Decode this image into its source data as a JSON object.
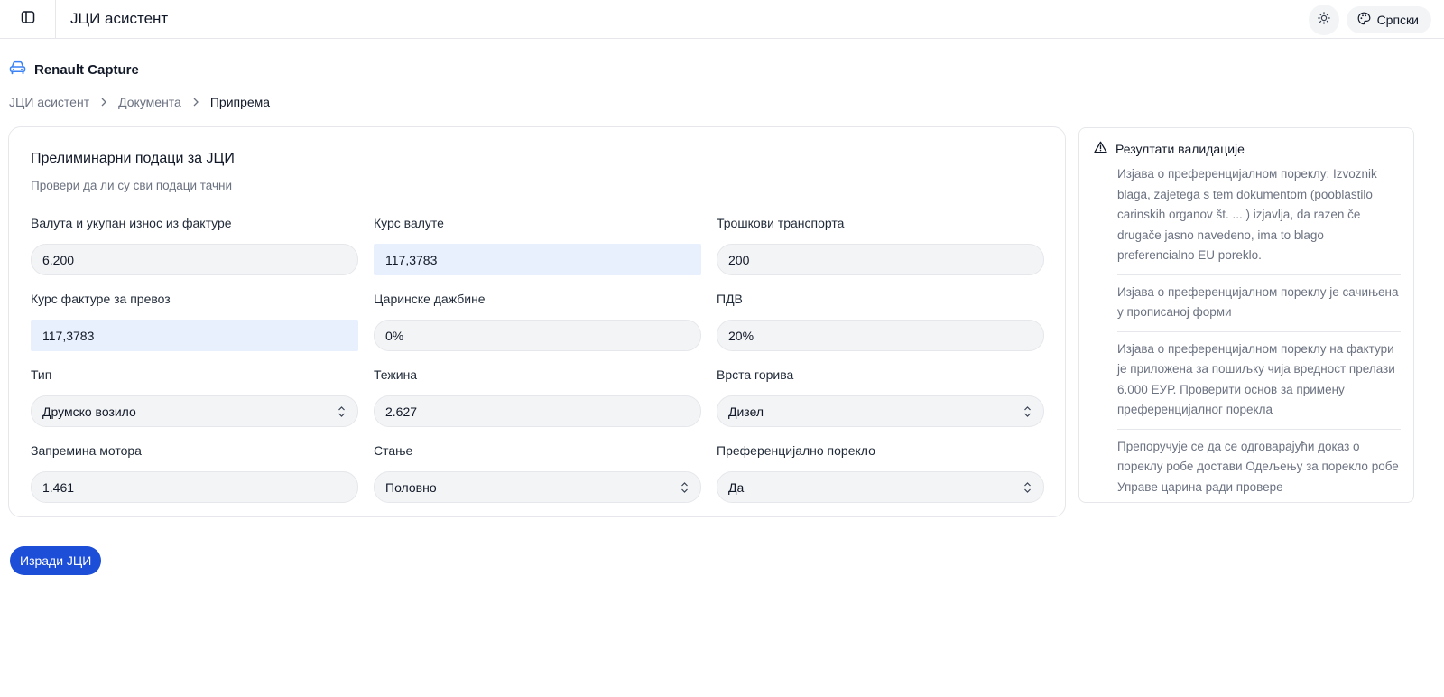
{
  "header": {
    "app_title": "ЈЦИ асистент",
    "language_label": "Српски"
  },
  "vehicle": {
    "name": "Renault Capture"
  },
  "breadcrumb": {
    "items": [
      "ЈЦИ асистент",
      "Документа",
      "Припрема"
    ]
  },
  "form": {
    "title": "Прелиминарни подаци за ЈЦИ",
    "subtitle": "Провери да ли су сви подаци тачни",
    "fields": [
      {
        "label": "Валута и укупан износ из фактуре",
        "value": "6.200",
        "type": "text"
      },
      {
        "label": "Курс валуте",
        "value": "117,3783",
        "type": "text",
        "highlighted": true
      },
      {
        "label": "Трошкови транспорта",
        "value": "200",
        "type": "text"
      },
      {
        "label": "Курс фактуре за превоз",
        "value": "117,3783",
        "type": "text",
        "highlighted": true
      },
      {
        "label": "Царинске дажбине",
        "value": "0%",
        "type": "text"
      },
      {
        "label": "ПДВ",
        "value": "20%",
        "type": "text"
      },
      {
        "label": "Тип",
        "value": "Друмско возило",
        "type": "select"
      },
      {
        "label": "Тежина",
        "value": "2.627",
        "type": "text"
      },
      {
        "label": "Врста горива",
        "value": "Дизел",
        "type": "select"
      },
      {
        "label": "Запремина мотора",
        "value": "1.461",
        "type": "text"
      },
      {
        "label": "Стање",
        "value": "Половно",
        "type": "select"
      },
      {
        "label": "Преференцијално порекло",
        "value": "Да",
        "type": "select"
      }
    ]
  },
  "validation": {
    "title": "Резултати валидације",
    "items": [
      "Изјава о преференцијалном пореклу: Izvoznik blaga, zajetega s tem dokumentom (pooblastilo carinskih organov št. ... ) izjavlja, da razen če drugače jasno navedeno, ima to blago preferencialno EU poreklo.",
      "Изјава о преференцијалном пореклу је сачињена у прописаној форми",
      "Изјава о преференцијалном пореклу на фактури је приложена за пошиљку чија вредност прелази 6.000 ЕУР. Проверити основ за примену преференцијалног порекла",
      "Препоручује се да се одговарајући доказ о пореклу робе достави Одељењу за порекло робе Управе царина ради провере"
    ]
  },
  "actions": {
    "create_label": "Изради ЈЦИ"
  },
  "colors": {
    "primary": "#1d4ed8",
    "highlight_field": "#e8f0fe",
    "field_bg": "#f3f4f6",
    "car_icon": "#3b82f6"
  },
  "icons": {
    "sidebar_toggle": "sidebar-panel-icon",
    "theme": "sun-icon",
    "language": "palette-icon",
    "vehicle": "car-icon",
    "validation": "warning-triangle-icon",
    "select": "chevron-up-down-icon"
  }
}
